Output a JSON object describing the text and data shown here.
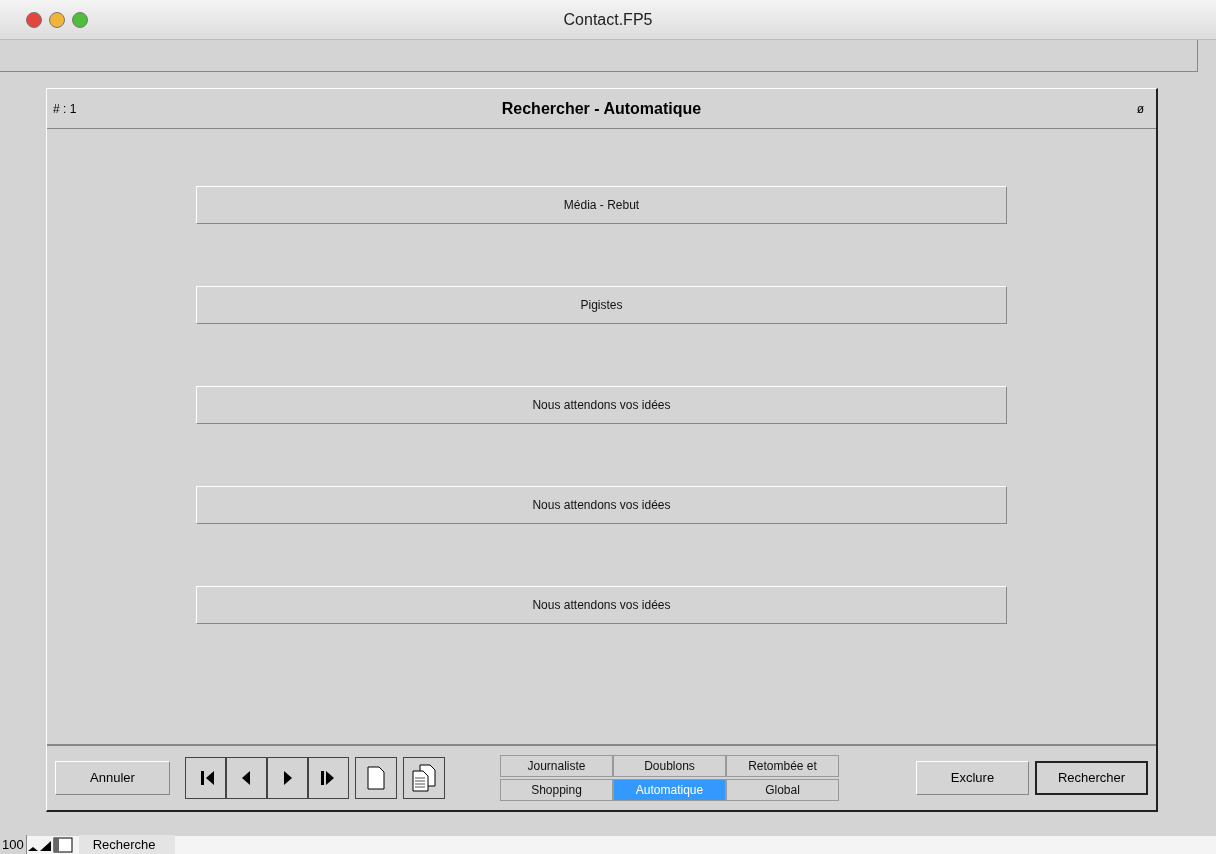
{
  "window": {
    "title": "Contact.FP5"
  },
  "header": {
    "record": "# : 1",
    "title": "Rechercher - Automatique",
    "mark": "ø"
  },
  "buttons": [
    "Média - Rebut",
    "Pigistes",
    "Nous attendons vos idées",
    "Nous attendons vos idées",
    "Nous attendons vos idées"
  ],
  "footer": {
    "cancel": "Annuler",
    "tabs": [
      {
        "label": "Journaliste",
        "selected": false
      },
      {
        "label": "Doublons",
        "selected": false
      },
      {
        "label": "Retombée et",
        "selected": false
      },
      {
        "label": "Shopping",
        "selected": false
      },
      {
        "label": "Automatique",
        "selected": true
      },
      {
        "label": "Global",
        "selected": false
      }
    ],
    "actions": [
      "Exclure",
      "Rechercher"
    ]
  },
  "status_bar": {
    "zoom": "100",
    "mode": "Recherche"
  }
}
